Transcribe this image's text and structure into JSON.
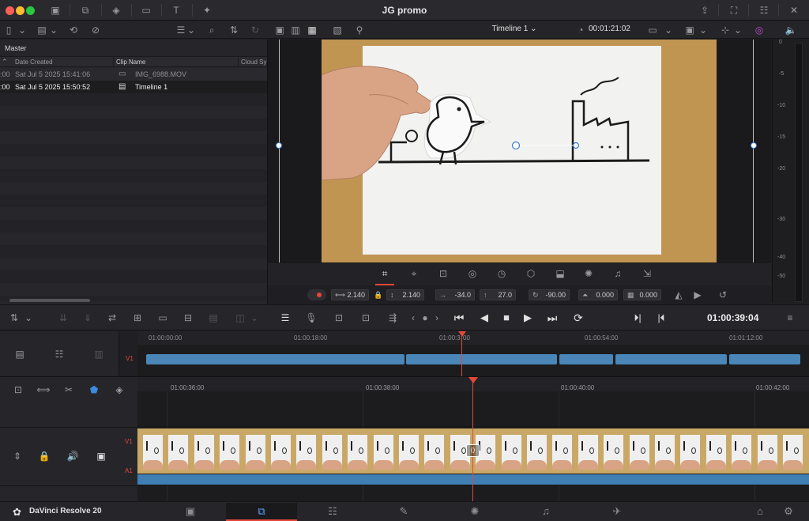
{
  "window": {
    "title": "JG promo"
  },
  "media_pool": {
    "bin": "Master",
    "columns": [
      "Date Created",
      "Clip Name",
      "Cloud Sy"
    ],
    "rows": [
      {
        "time_prefix": ":00",
        "date": "Sat Jul 5 2025 15:41:06",
        "name": "IMG_6988.MOV"
      },
      {
        "time_prefix": ":00",
        "date": "Sat Jul 5 2025 15:50:52",
        "name": "Timeline 1"
      }
    ]
  },
  "viewer": {
    "timeline_name": "Timeline 1",
    "timecode": "00:01:21:02"
  },
  "transform": {
    "zoom_x": "2.140",
    "zoom_y": "2.140",
    "pos_x": "-34.0",
    "pos_y": "27.0",
    "rotation": "-90.00",
    "pitch": "0.000",
    "yaw": "0.000"
  },
  "meter": {
    "labels": [
      "0",
      "-5",
      "-10",
      "-15",
      "-20",
      "-30",
      "-40",
      "-50"
    ]
  },
  "transport": {
    "timecode": "01:00:39:04"
  },
  "upper_ruler": [
    "01:00:00:00",
    "01:00:18:00",
    "01:00:3",
    "00",
    "01:00:54:00",
    "01:01:12:00"
  ],
  "lower_ruler": [
    "01:00:36:00",
    "01:00:38:00",
    "01:00:40:00",
    "01:00:42:00"
  ],
  "tracks": {
    "v1": "V1",
    "a1": "A1"
  },
  "app_name": "DaVinci Resolve 20",
  "colors": {
    "accent": "#e5473a",
    "clip": "#4a86b8",
    "active_page": "#e5473a"
  }
}
